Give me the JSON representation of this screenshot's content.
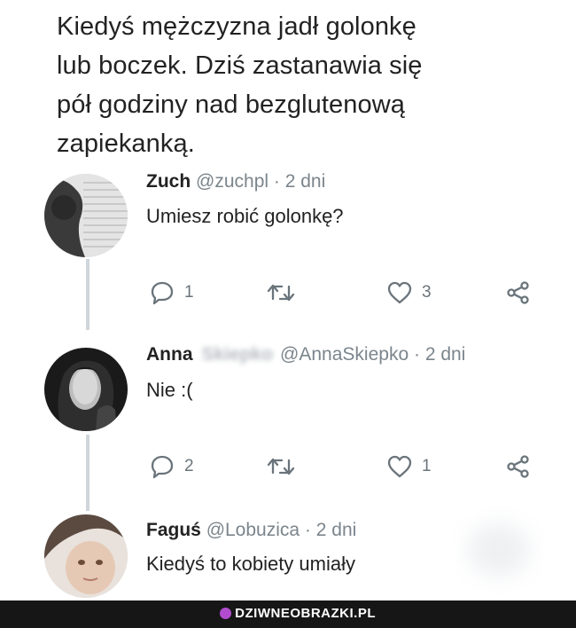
{
  "main_tweet": {
    "lines": [
      "Kiedyś mężczyzna jadł golonkę",
      "lub boczek. Dziś zastanawia się",
      "pół godziny nad bezglutenową",
      "zapiekanką."
    ]
  },
  "replies": [
    {
      "name": "Zuch",
      "surname": "",
      "handle": "@zuchpl",
      "separator": "·",
      "time": "2 dni",
      "text": "Umiesz robić golonkę?",
      "reply_count": "1",
      "retweet_count": "",
      "like_count": "3"
    },
    {
      "name": "Anna",
      "surname": "Skiepko",
      "handle": "@AnnaSkiepko",
      "separator": "·",
      "time": "2 dni",
      "text": "Nie :(",
      "reply_count": "2",
      "retweet_count": "",
      "like_count": "1"
    },
    {
      "name": "Faguś",
      "surname": "",
      "handle": "@Lobuzica",
      "separator": "·",
      "time": "2 dni",
      "text": "Kiedyś to kobiety umiały"
    }
  ],
  "footer": {
    "brand": "DZIWNEOBRAZKI.PL"
  },
  "icons": {
    "reply": "speech-bubble-icon",
    "retweet": "retweet-icon",
    "like": "heart-icon",
    "share": "share-icon"
  },
  "colors": {
    "icon_gray": "#6a747b",
    "thread_line": "#cfd6dc",
    "footer_bg": "#161616",
    "brand_accent": "#b14ccf"
  }
}
